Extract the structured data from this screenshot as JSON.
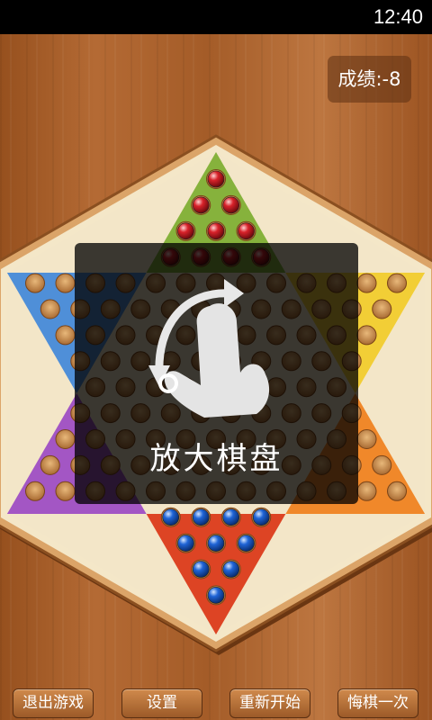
{
  "status_bar": {
    "time": "12:40"
  },
  "score": {
    "text": "成绩:-8"
  },
  "overlay": {
    "hint": "放大棋盘",
    "icon": "pinch-zoom-gesture-icon"
  },
  "buttons": {
    "quit": "退出游戏",
    "settings": "设置",
    "restart": "重新开始",
    "undo": "悔棋一次"
  },
  "colors": {
    "top": "#86b23c",
    "upper_left": "#4f8fd8",
    "upper_right": "#f2ce36",
    "lower_left": "#a356c4",
    "lower_right": "#f0882a",
    "bottom": "#dd4424",
    "center": "#f3e6c8",
    "red_marble": "#d8222a",
    "blue_marble": "#1f64d6"
  }
}
